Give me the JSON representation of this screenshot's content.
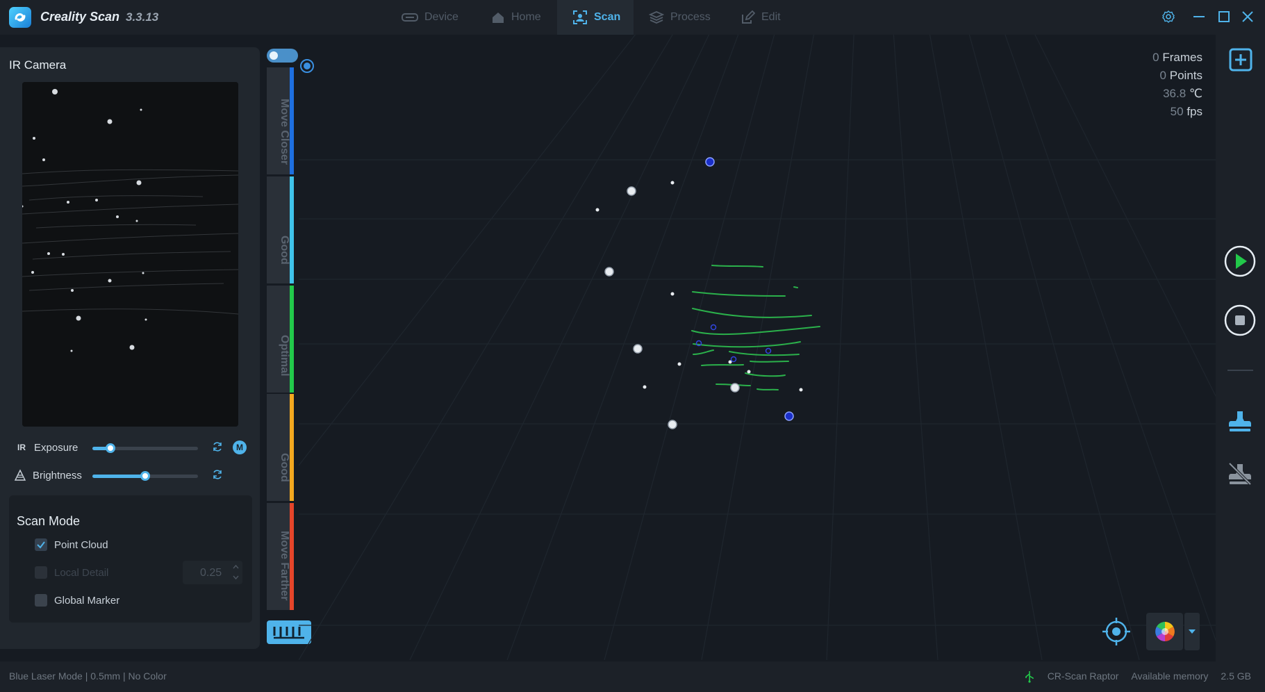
{
  "app": {
    "title": "Creality Scan",
    "version": "3.3.13"
  },
  "tabs": [
    {
      "label": "Device",
      "icon": "device-icon"
    },
    {
      "label": "Home",
      "icon": "home-icon"
    },
    {
      "label": "Scan",
      "icon": "scan-icon",
      "active": true
    },
    {
      "label": "Process",
      "icon": "layers-icon"
    },
    {
      "label": "Edit",
      "icon": "edit-icon"
    }
  ],
  "left_panel": {
    "title": "IR Camera",
    "rotate_label": "90",
    "exposure": {
      "prefix": "IR",
      "label": "Exposure",
      "value": 0.17,
      "mode_badge": "M"
    },
    "brightness": {
      "label": "Brightness",
      "value": 0.5
    },
    "scan_mode": {
      "title": "Scan Mode",
      "options": [
        {
          "label": "Point Cloud",
          "checked": true,
          "disabled": false
        },
        {
          "label": "Local Detail",
          "checked": false,
          "disabled": true,
          "value": "0.25"
        },
        {
          "label": "Global Marker",
          "checked": false,
          "disabled": false
        }
      ]
    }
  },
  "distance_bar": {
    "segments": [
      {
        "label": "Move Closer",
        "color": "#1e6fe0"
      },
      {
        "label": "Good",
        "color": "#3fc3ea"
      },
      {
        "label": "Optimal",
        "color": "#22c94a"
      },
      {
        "label": "Good",
        "color": "#f3a81f"
      },
      {
        "label": "Move Farther",
        "color": "#e5452a"
      }
    ]
  },
  "stats": [
    {
      "value": "0",
      "unit": "Frames"
    },
    {
      "value": "0",
      "unit": "Points"
    },
    {
      "value": "36.8",
      "unit": "℃"
    },
    {
      "value": "50",
      "unit": "fps"
    }
  ],
  "statusbar": {
    "mode": "Blue Laser Mode",
    "resolution": "0.5mm",
    "color_mode": "No Color",
    "device": "CR-Scan Raptor",
    "memory_label": "Available memory",
    "memory_value": "2.5 GB"
  },
  "colors": {
    "accent": "#4fb3ea",
    "scan_points": "#2bb14b",
    "play": "#22c94a"
  }
}
